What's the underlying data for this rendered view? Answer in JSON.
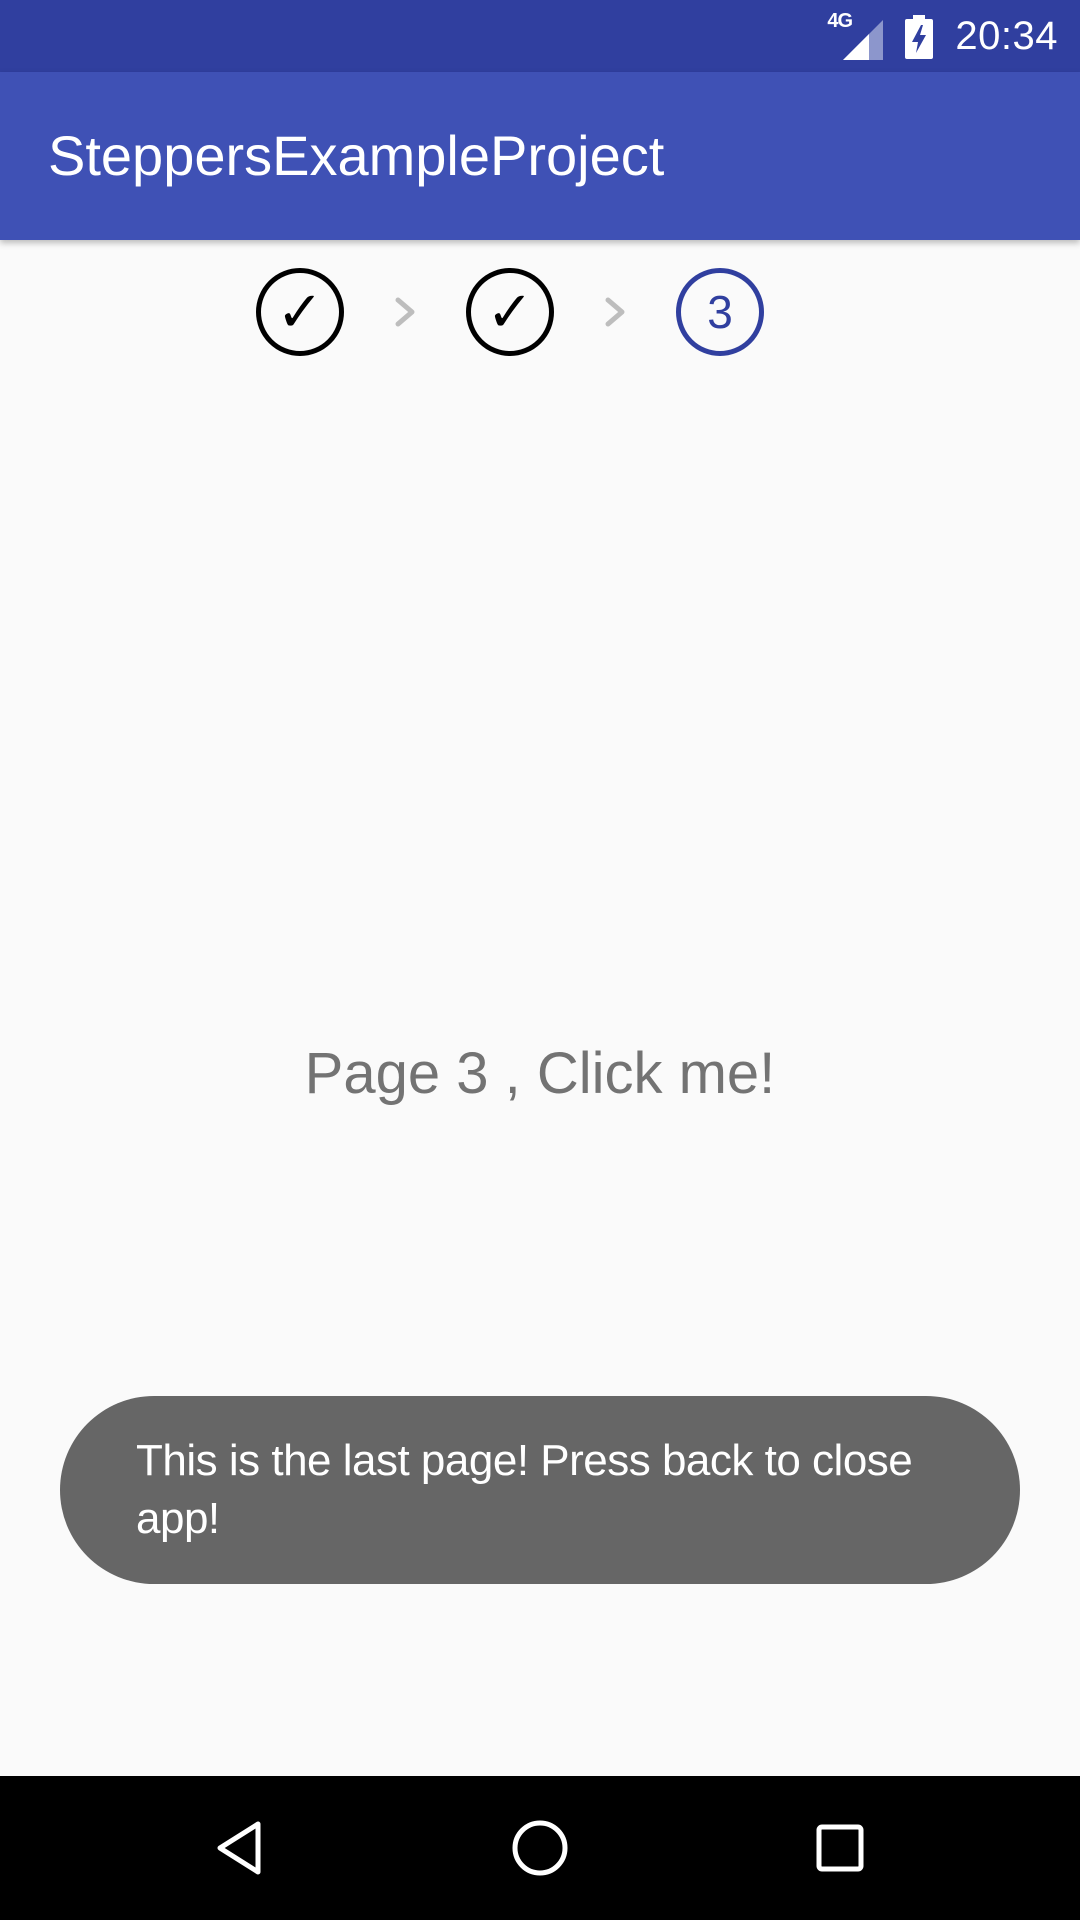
{
  "status_bar": {
    "network": "4G",
    "time": "20:34"
  },
  "app_bar": {
    "title": "SteppersExampleProject"
  },
  "stepper": {
    "steps": [
      {
        "label": "✓",
        "state": "completed"
      },
      {
        "label": "✓",
        "state": "completed"
      },
      {
        "label": "3",
        "state": "active"
      }
    ]
  },
  "page": {
    "label": "Page 3 , Click me!"
  },
  "toast": {
    "message": "This is the last page! Press back to close app!"
  },
  "colors": {
    "status_bar": "#303f9f",
    "app_bar": "#3f51b5",
    "active_step": "#303f9f",
    "toast_bg": "#666666"
  }
}
